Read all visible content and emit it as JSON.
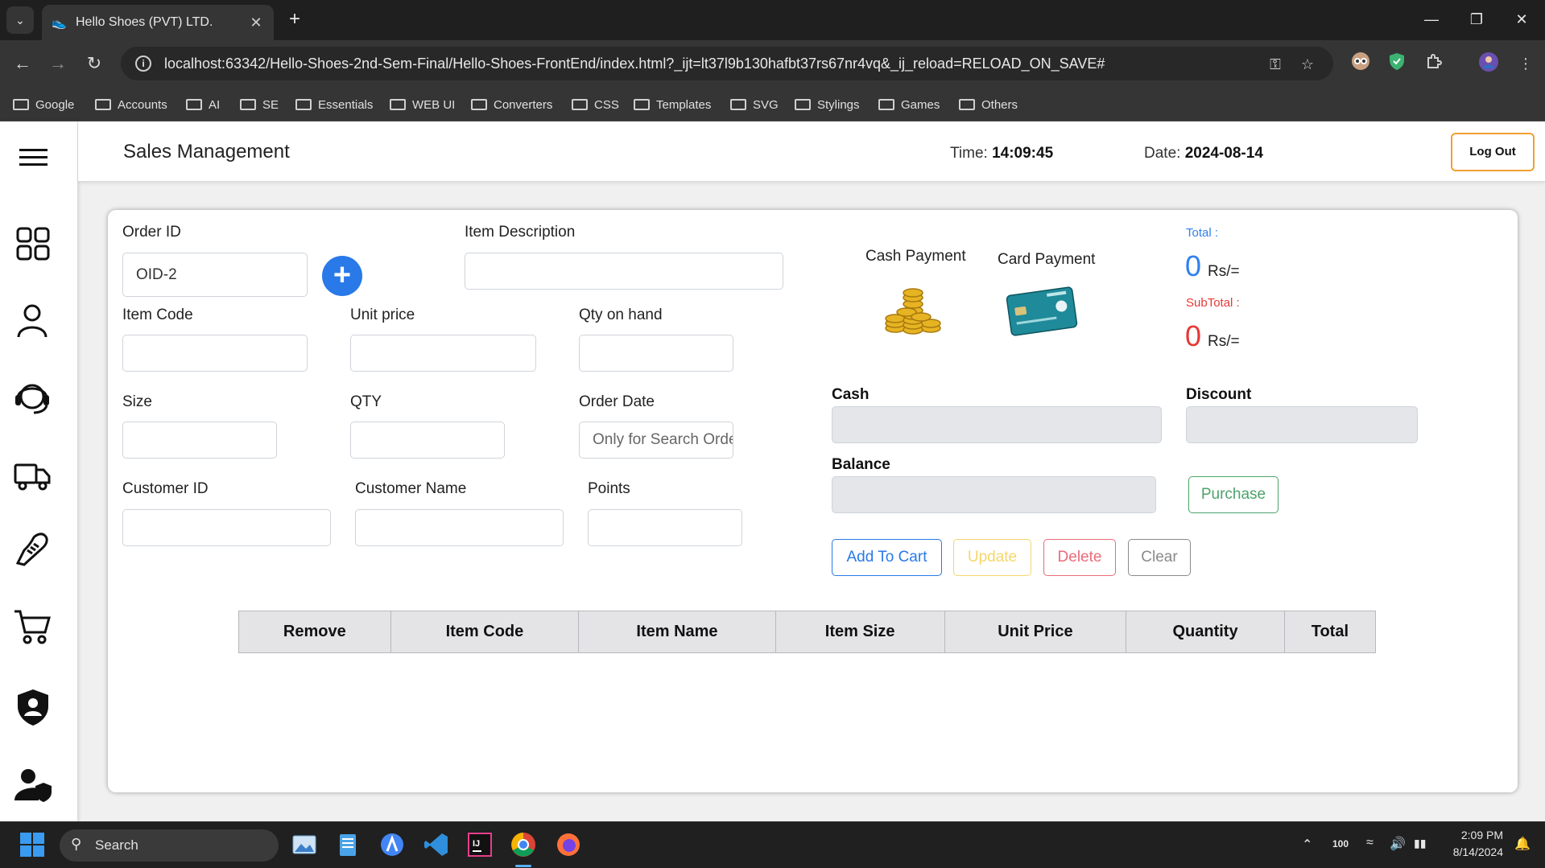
{
  "browser": {
    "tab_title": "Hello Shoes (PVT) LTD.",
    "url": "localhost:63342/Hello-Shoes-2nd-Sem-Final/Hello-Shoes-FrontEnd/index.html?_ijt=lt37l9b130hafbt37rs67nr4vq&_ij_reload=RELOAD_ON_SAVE#",
    "bookmarks": [
      "Google",
      "Accounts",
      "AI",
      "SE",
      "Essentials",
      "WEB UI",
      "Converters",
      "CSS",
      "Templates",
      "SVG",
      "Stylings",
      "Games",
      "Others"
    ]
  },
  "header": {
    "title": "Sales Management",
    "time_label": "Time:",
    "time_value": "14:09:45",
    "date_label": "Date:",
    "date_value": "2024-08-14",
    "logout_label": "Log Out"
  },
  "form": {
    "order_id_label": "Order ID",
    "order_id_value": "OID-2",
    "item_description_label": "Item Description",
    "item_code_label": "Item Code",
    "unit_price_label": "Unit price",
    "qty_on_hand_label": "Qty on hand",
    "size_label": "Size",
    "qty_label": "QTY",
    "order_date_label": "Order Date",
    "order_date_placeholder": "Only for Search Orders",
    "customer_id_label": "Customer ID",
    "customer_name_label": "Customer Name",
    "points_label": "Points"
  },
  "payment": {
    "cash_payment_label": "Cash Payment",
    "card_payment_label": "Card Payment",
    "total_label": "Total :",
    "total_value": "0",
    "subtotal_label": "SubTotal :",
    "subtotal_value": "0",
    "currency": "Rs/=",
    "cash_label": "Cash",
    "discount_label": "Discount",
    "balance_label": "Balance",
    "purchase_label": "Purchase"
  },
  "actions": {
    "add_to_cart": "Add To Cart",
    "update": "Update",
    "delete": "Delete",
    "clear": "Clear"
  },
  "cart_table": {
    "columns": [
      "Remove",
      "Item Code",
      "Item Name",
      "Item Size",
      "Unit Price",
      "Quantity",
      "Total"
    ]
  },
  "taskbar": {
    "search_label": "Search",
    "battery_value": "100",
    "clock_time": "2:09 PM",
    "clock_date": "8/14/2024"
  },
  "colors": {
    "primary_blue": "#2979e8",
    "total_blue": "#2f80ed",
    "subtotal_red": "#e53935",
    "update_yellow": "#f5d66b",
    "delete_red": "#ea6b78",
    "purchase_green": "#4ca36a",
    "logout_orange": "#f0a030"
  }
}
